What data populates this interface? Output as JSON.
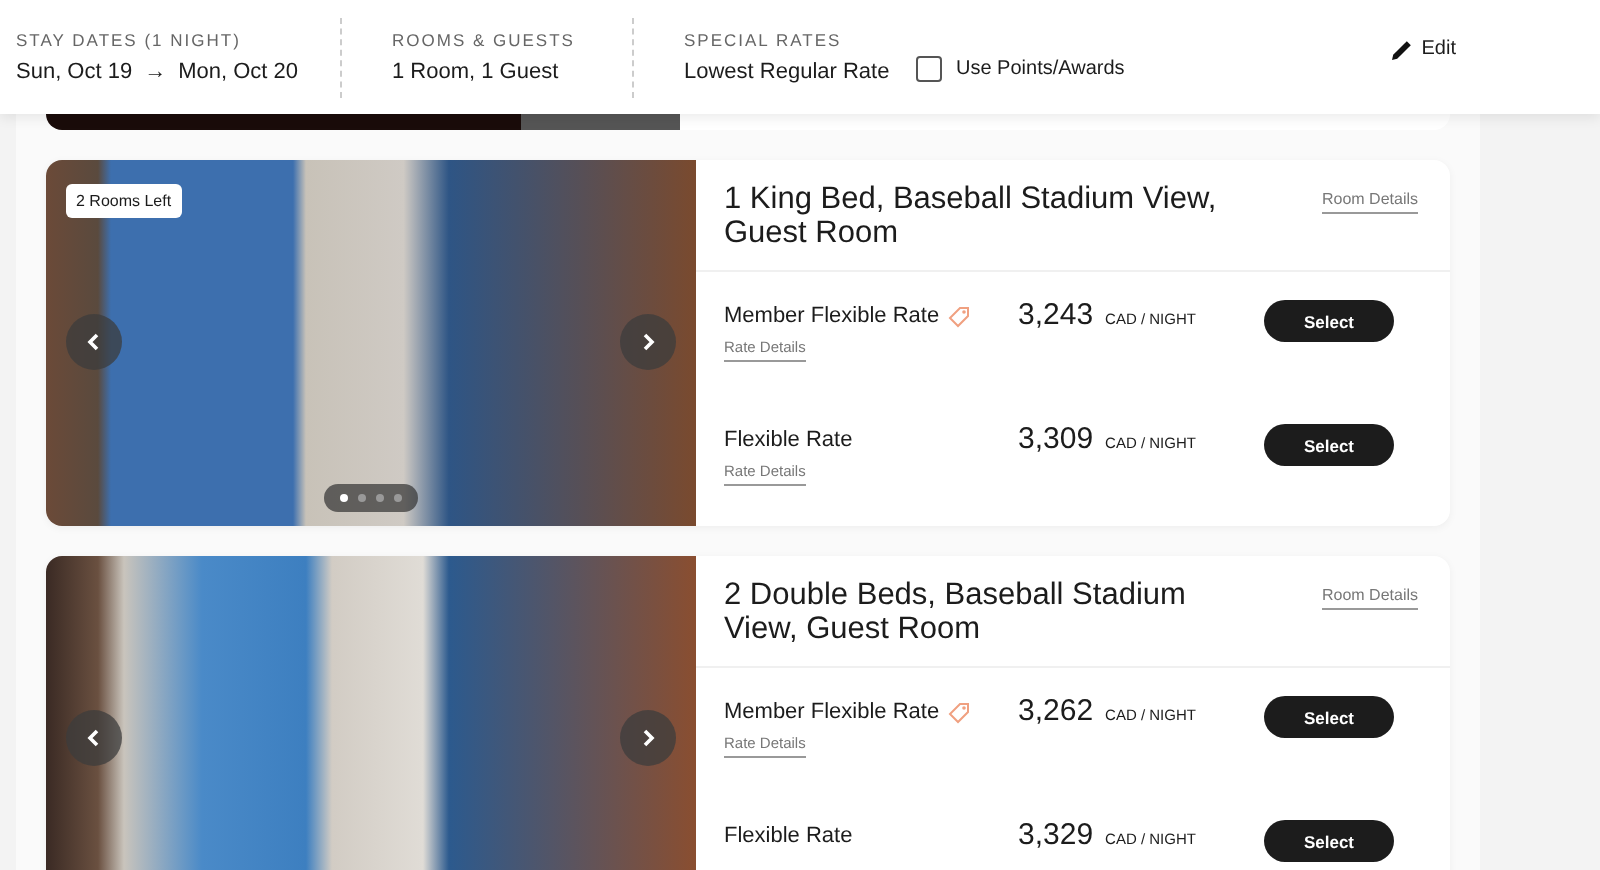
{
  "header": {
    "stay": {
      "label": "STAY DATES (1 NIGHT)",
      "from": "Sun, Oct 19",
      "arrow": "→",
      "to": "Mon, Oct 20"
    },
    "guests": {
      "label": "ROOMS & GUESTS",
      "value": "1 Room, 1 Guest"
    },
    "special": {
      "label": "SPECIAL RATES",
      "value": "Lowest Regular Rate"
    },
    "points": {
      "label": "Use Points/Awards",
      "checked": false
    },
    "edit": "Edit"
  },
  "rooms": [
    {
      "badge": "2 Rooms Left",
      "dots": [
        {
          "selected": true
        },
        {
          "selected": false
        },
        {
          "selected": false
        },
        {
          "selected": false
        }
      ],
      "title": "1 King Bed, Baseball Stadium View, Guest Room",
      "details": "Room Details",
      "rates": [
        {
          "name": "Member Flexible Rate",
          "member": true,
          "price": "3,243",
          "unit": "CAD / NIGHT",
          "details": "Rate Details",
          "button": "Select"
        },
        {
          "name": "Flexible Rate",
          "member": false,
          "price": "3,309",
          "unit": "CAD / NIGHT",
          "details": "Rate Details",
          "button": "Select"
        }
      ]
    },
    {
      "title": "2 Double Beds, Baseball Stadium View, Guest Room",
      "details": "Room Details",
      "rates": [
        {
          "name": "Member Flexible Rate",
          "member": true,
          "price": "3,262",
          "unit": "CAD / NIGHT",
          "details": "Rate Details",
          "button": "Select"
        },
        {
          "name": "Flexible Rate",
          "member": false,
          "price": "3,329",
          "unit": "CAD / NIGHT",
          "button": "Select"
        }
      ]
    }
  ]
}
